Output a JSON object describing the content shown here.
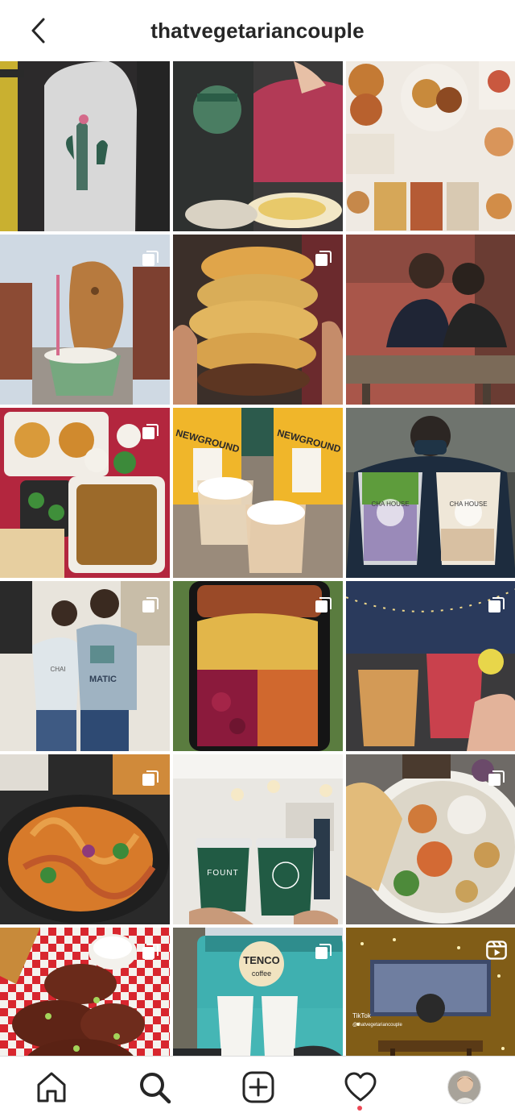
{
  "header": {
    "username": "thatvegetariancouple",
    "back_icon": "chevron-left-icon"
  },
  "grid": {
    "rows": [
      [
        {
          "subject": "cactus t-shirt",
          "overlay": "none"
        },
        {
          "subject": "graphic t-shirt with plate",
          "overlay": "none"
        },
        {
          "subject": "food collage",
          "overlay": "none"
        }
      ],
      [
        {
          "subject": "taiyaki ice cream",
          "overlay": "carousel-icon"
        },
        {
          "subject": "fried stack sandwich",
          "overlay": "carousel-icon"
        },
        {
          "subject": "couple at table",
          "overlay": "none"
        }
      ],
      [
        {
          "subject": "indian takeout spread",
          "overlay": "carousel-icon"
        },
        {
          "subject": "newground lattes",
          "overlay": "none"
        },
        {
          "subject": "cha house bubble tea",
          "overlay": "none"
        }
      ],
      [
        {
          "subject": "couple at cafe",
          "overlay": "carousel-icon"
        },
        {
          "subject": "meal container",
          "overlay": "carousel-icon"
        },
        {
          "subject": "cocktails under lights",
          "overlay": "carousel-icon"
        }
      ],
      [
        {
          "subject": "noodle salad",
          "overlay": "carousel-icon"
        },
        {
          "subject": "fount coffee cups",
          "overlay": "none"
        },
        {
          "subject": "mezze bowl",
          "overlay": "carousel-icon"
        }
      ],
      [
        {
          "subject": "fried wings",
          "overlay": "carousel-icon"
        },
        {
          "subject": "tenco coffee truck",
          "overlay": "carousel-icon"
        },
        {
          "subject": "lit patio",
          "overlay": "reels-icon"
        }
      ]
    ],
    "tile_text": {
      "newground_label": "NEWGROUND",
      "chahouse_label": "CHA HOUSE",
      "shirt_text": "MATIC",
      "cafe_text": "CHAI",
      "fount_label": "FOUNT",
      "tenco_label": "TENCO",
      "tenco_sub": "coffee",
      "tiktok_label": "TikTok",
      "tiktok_handle": "@thatvegetariancouple"
    }
  },
  "nav": {
    "items": [
      "home-icon",
      "search-icon",
      "new-post-icon",
      "activity-icon",
      "profile-avatar"
    ],
    "active": "search-icon",
    "has_activity_notification": true
  },
  "colors": {
    "text": "#262626",
    "divider": "#dbdbdb",
    "notification": "#ed4956"
  }
}
